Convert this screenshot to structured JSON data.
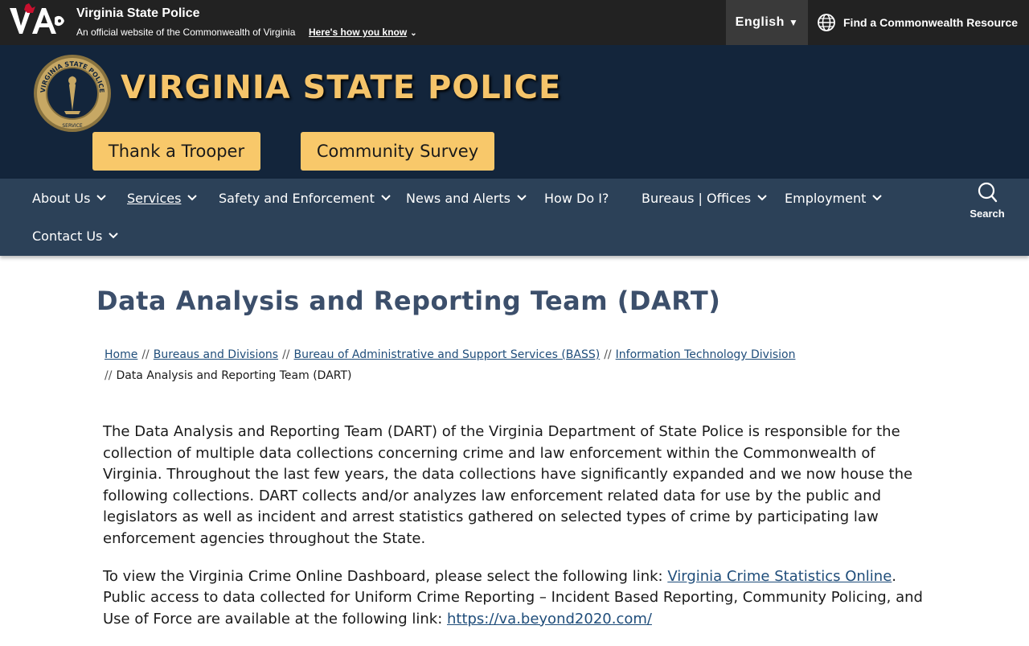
{
  "utility_bar": {
    "logo_text": "VA",
    "site_name": "Virginia State Police",
    "official_text": "An official website of the Commonwealth of Virginia",
    "how_know_label": "Here's how you know",
    "language_label": "English",
    "find_resource_label": "Find a Commonwealth Resource"
  },
  "header": {
    "title": "VIRGINIA STATE POLICE",
    "seal_text_top": "VIRGINIA STATE POLICE",
    "seal_text_bottom": "SERVICE",
    "buttons": [
      "Thank a Trooper",
      "Community Survey"
    ]
  },
  "nav": {
    "items": [
      {
        "label": "About Us",
        "dropdown": true
      },
      {
        "label": "Services",
        "dropdown": true
      },
      {
        "label": "Safety and Enforcement",
        "dropdown": true
      },
      {
        "label": "News and Alerts",
        "dropdown": true
      },
      {
        "label": "How Do I?",
        "dropdown": false
      },
      {
        "label": "Bureaus | Offices",
        "dropdown": true
      },
      {
        "label": "Employment",
        "dropdown": true
      },
      {
        "label": "Contact Us",
        "dropdown": true
      }
    ],
    "search_label": "Search"
  },
  "page": {
    "title": "Data Analysis and Reporting Team (DART)",
    "breadcrumb": [
      "Home",
      "Bureaus and Divisions",
      "Bureau of Administrative and Support Services (BASS)",
      "Information Technology Division",
      "Data Analysis and Reporting Team (DART)"
    ],
    "breadcrumb_separator": "//",
    "paragraph1": "The Data Analysis and Reporting Team (DART) of the Virginia Department of State Police is responsible for the collection of multiple data collections concerning crime and law enforcement within the Commonwealth of Virginia. Throughout the last few years, the data collections have significantly expanded and we now house the following collections. DART collects and/or analyzes law enforcement related data for use by the public and legislators as well as incident and arrest statistics gathered on selected types of crime by participating law enforcement agencies throughout the State.",
    "paragraph2_pre": "To view the Virginia Crime Online Dashboard, please select the following link: ",
    "paragraph2_link1": "Virginia Crime Statistics Online",
    "paragraph2_mid": ". Public access to data collected for Uniform Crime Reporting – Incident Based Reporting, Community Policing, and Use of Force are available at the following link: ",
    "paragraph2_link2": "https://va.beyond2020.com/"
  },
  "colors": {
    "utility_bg": "#222222",
    "header_bg": "#13253b",
    "nav_bg": "#2c4158",
    "accent_gold": "#f8c86a",
    "title_gold": "#f5c46a",
    "page_title": "#3c4f6b",
    "link": "#1f4d7a"
  }
}
